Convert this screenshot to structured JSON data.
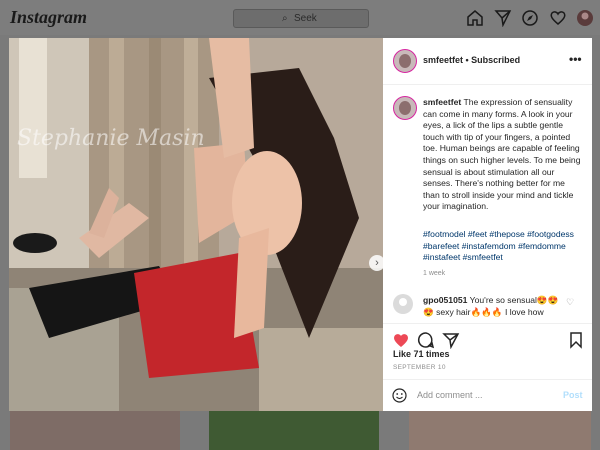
{
  "app": {
    "logo": "Instagram"
  },
  "search": {
    "placeholder": "Seek",
    "icon": "search-icon"
  },
  "nav": {
    "icons": [
      "home-icon",
      "direct-icon",
      "explore-icon",
      "heart-icon",
      "profile-avatar"
    ]
  },
  "photo": {
    "watermark": "Stephanie Masin",
    "next_icon": "chevron-right-icon",
    "carousel": {
      "count": 2,
      "active": 1
    }
  },
  "post": {
    "username": "smfeetfet",
    "separator": " • ",
    "status": "Subscribed",
    "more_label": "•••",
    "caption": "The expression of sensuality can come in many forms. A look in your eyes, a lick of the lips a subtle gentle touch with tip of your fingers, a pointed toe. Human beings are capable of feeling things on such higher levels. To me being sensual is about stimulation all our senses. There's nothing better for me than to stroll inside your mind and tickle your imagination.",
    "hashtags": "#footmodel #feet #thepose #footgodess #barefeet #instafemdom #femdomme #instafeet #smfeetfet",
    "caption_time": "1 week",
    "comment": {
      "username": "gpo051051",
      "text": "You're so sensual😍😍😍 sexy hair🔥🔥🔥 I love how"
    },
    "likes": "Like 71 times",
    "date": "SEPTEMBER 10",
    "add_comment_placeholder": "Add comment ...",
    "post_label": "Post"
  },
  "colors": {
    "like": "#ed4956",
    "link": "#00376b",
    "post_disabled": "#b2dffc",
    "muted": "#8e8e8e"
  }
}
